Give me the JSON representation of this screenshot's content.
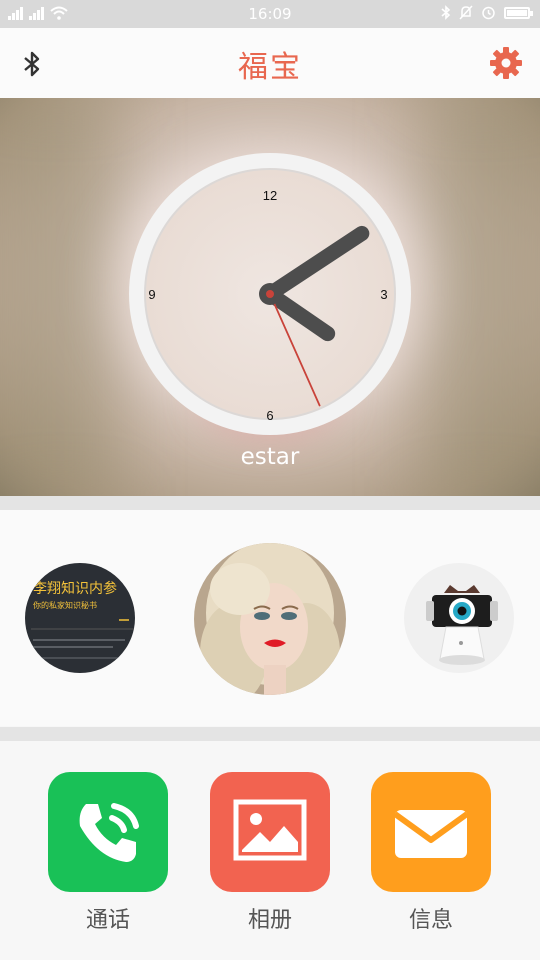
{
  "status_bar": {
    "time": "16:09",
    "signal_icons": [
      "signal-icon",
      "signal-icon",
      "wifi-icon"
    ],
    "right_icons": [
      "bluetooth-icon",
      "mute-icon",
      "alarm-icon",
      "battery-icon"
    ]
  },
  "header": {
    "title": "福宝",
    "left_icon": "bluetooth-icon",
    "right_icon": "gear-icon",
    "accent_color": "#e8674f"
  },
  "clock": {
    "numerals": [
      "12",
      "3",
      "6",
      "9"
    ],
    "owner_name": "estar",
    "hour": 4,
    "minute": 9,
    "second": 26
  },
  "contacts": {
    "items": [
      {
        "name": "book-contact",
        "title": "李翔知识内参",
        "subtitle": "你的私家知识秘书"
      },
      {
        "name": "woman-contact"
      },
      {
        "name": "robot-contact"
      }
    ]
  },
  "apps": [
    {
      "label": "通话",
      "icon": "phone-icon",
      "color": "#19c157"
    },
    {
      "label": "相册",
      "icon": "photo-icon",
      "color": "#f26350"
    },
    {
      "label": "信息",
      "icon": "mail-icon",
      "color": "#ff9e1d"
    }
  ]
}
